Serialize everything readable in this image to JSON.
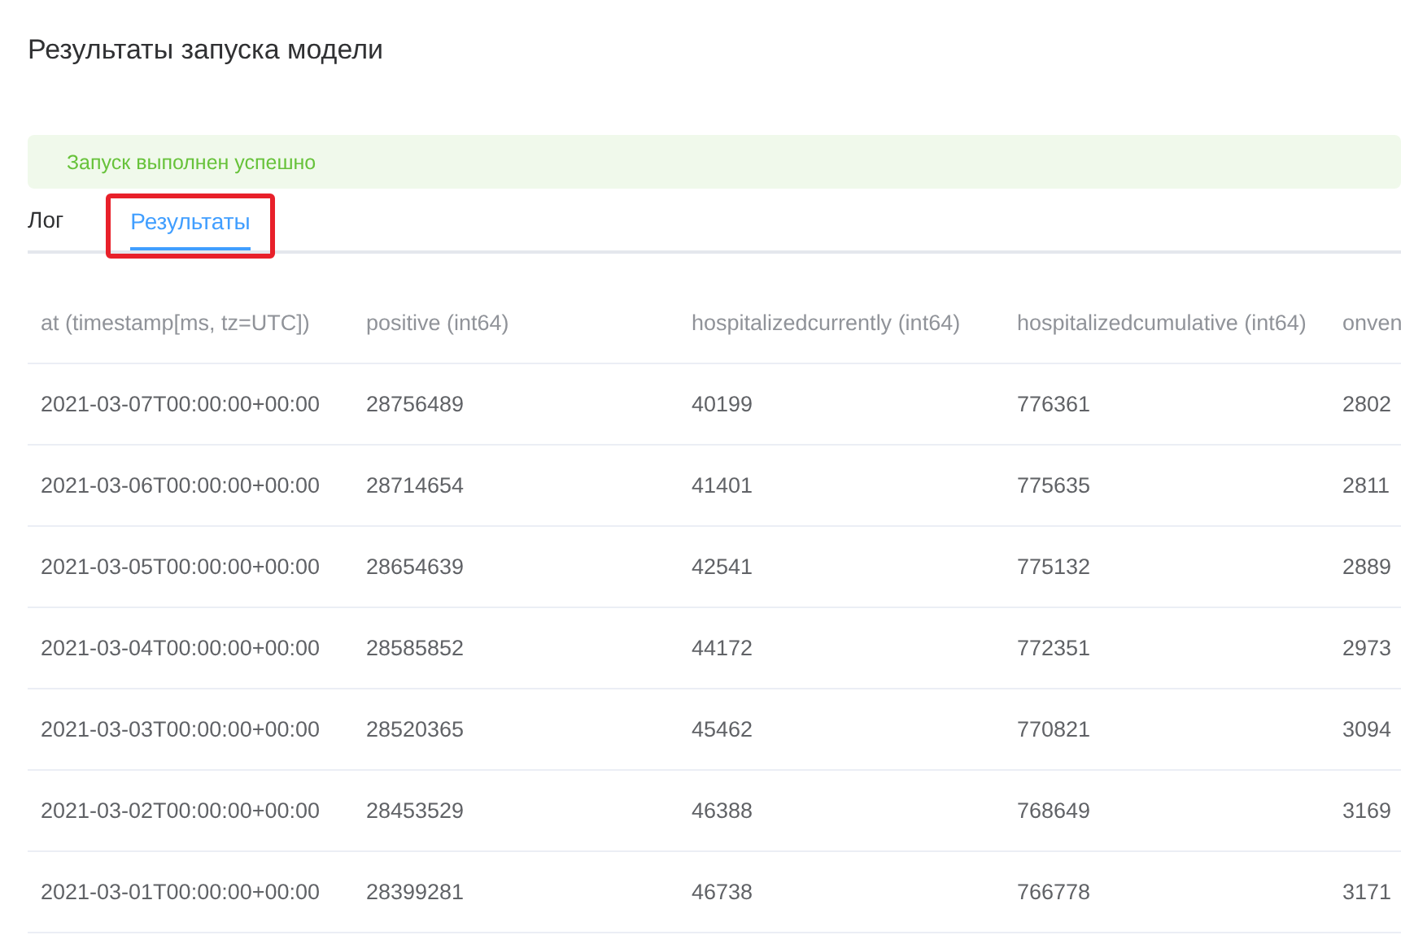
{
  "title": "Результаты запуска модели",
  "alert": {
    "kind": "success",
    "text": "Запуск выполнен успешно"
  },
  "tabs": [
    {
      "label": "Лог",
      "selected": false,
      "highlighted": false
    },
    {
      "label": "Результаты",
      "selected": true,
      "highlighted": true
    }
  ],
  "table": {
    "columns": [
      "at (timestamp[ms, tz=UTC])",
      "positive (int64)",
      "hospitalizedcurrently (int64)",
      "hospitalizedcumulative (int64)",
      "onven"
    ],
    "rows": [
      [
        "2021-03-07T00:00:00+00:00",
        "28756489",
        "40199",
        "776361",
        "2802"
      ],
      [
        "2021-03-06T00:00:00+00:00",
        "28714654",
        "41401",
        "775635",
        "2811"
      ],
      [
        "2021-03-05T00:00:00+00:00",
        "28654639",
        "42541",
        "775132",
        "2889"
      ],
      [
        "2021-03-04T00:00:00+00:00",
        "28585852",
        "44172",
        "772351",
        "2973"
      ],
      [
        "2021-03-03T00:00:00+00:00",
        "28520365",
        "45462",
        "770821",
        "3094"
      ],
      [
        "2021-03-02T00:00:00+00:00",
        "28453529",
        "46388",
        "768649",
        "3169"
      ],
      [
        "2021-03-01T00:00:00+00:00",
        "28399281",
        "46738",
        "766778",
        "3171"
      ]
    ]
  }
}
